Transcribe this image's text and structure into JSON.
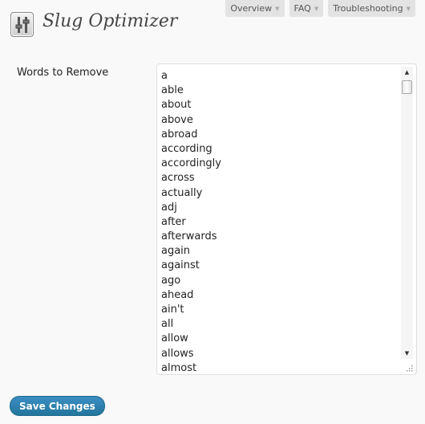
{
  "header": {
    "title": "Slug Optimizer",
    "icon": "settings-sliders-icon"
  },
  "help_tabs": [
    {
      "label": "Overview"
    },
    {
      "label": "FAQ"
    },
    {
      "label": "Troubleshooting"
    }
  ],
  "form": {
    "words_label": "Words to Remove",
    "words": [
      "a",
      "able",
      "about",
      "above",
      "abroad",
      "according",
      "accordingly",
      "across",
      "actually",
      "adj",
      "after",
      "afterwards",
      "again",
      "against",
      "ago",
      "ahead",
      "ain't",
      "all",
      "allow",
      "allows",
      "almost"
    ],
    "save_label": "Save Changes"
  },
  "colors": {
    "accent": "#21759b",
    "background": "#f9f9f9"
  }
}
